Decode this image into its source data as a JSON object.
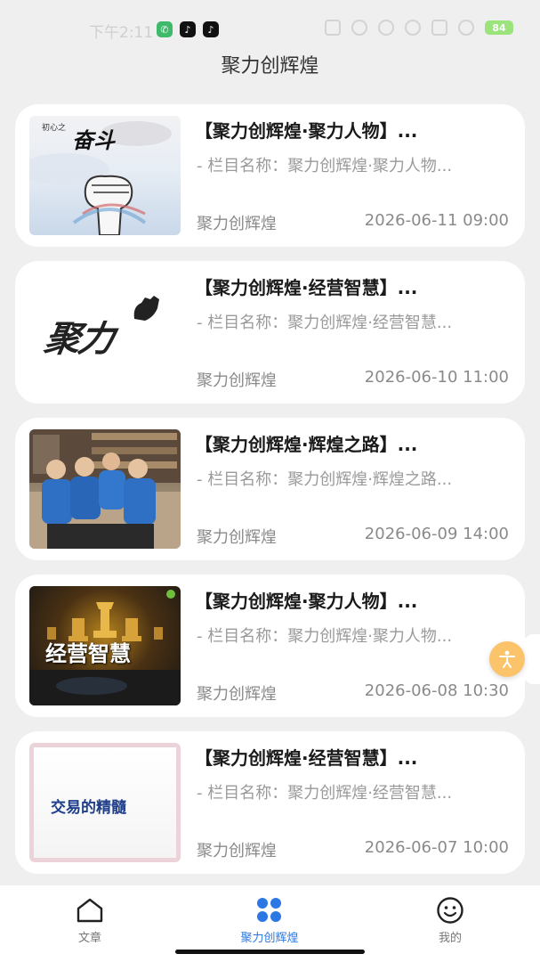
{
  "status_bar": {
    "time": "下午2:11",
    "battery": "84"
  },
  "header": {
    "title": "聚力创辉煌"
  },
  "articles": [
    {
      "title": "【聚力创辉煌·聚力人物】...",
      "desc": "- 栏目名称：聚力创辉煌·聚力人物...",
      "source": "聚力创辉煌",
      "date": "2026-06-11 09:00",
      "thumb_text_main": "奋斗",
      "thumb_text_small": "初心之"
    },
    {
      "title": "【聚力创辉煌·经营智慧】...",
      "desc": "- 栏目名称：聚力创辉煌·经营智慧...",
      "source": "聚力创辉煌",
      "date": "2026-06-10 11:00",
      "thumb_text_main": "聚力"
    },
    {
      "title": "【聚力创辉煌·辉煌之路】...",
      "desc": "- 栏目名称：聚力创辉煌·辉煌之路...",
      "source": "聚力创辉煌",
      "date": "2026-06-09 14:00"
    },
    {
      "title": "【聚力创辉煌·聚力人物】...",
      "desc": "- 栏目名称：聚力创辉煌·聚力人物...",
      "source": "聚力创辉煌",
      "date": "2026-06-08 10:30",
      "thumb_text_main": "经营智慧"
    },
    {
      "title": "【聚力创辉煌·经营智慧】...",
      "desc": "- 栏目名称：聚力创辉煌·经营智慧...",
      "source": "聚力创辉煌",
      "date": "2026-06-07 10:00",
      "thumb_text_main": "交易的精髓"
    }
  ],
  "bottom_nav": [
    {
      "label": "文章",
      "icon": "home-icon"
    },
    {
      "label": "聚力创辉煌",
      "icon": "grid-icon",
      "active": true
    },
    {
      "label": "我的",
      "icon": "smile-icon"
    }
  ],
  "colors": {
    "accent": "#2b78e4",
    "background": "#efefef"
  }
}
